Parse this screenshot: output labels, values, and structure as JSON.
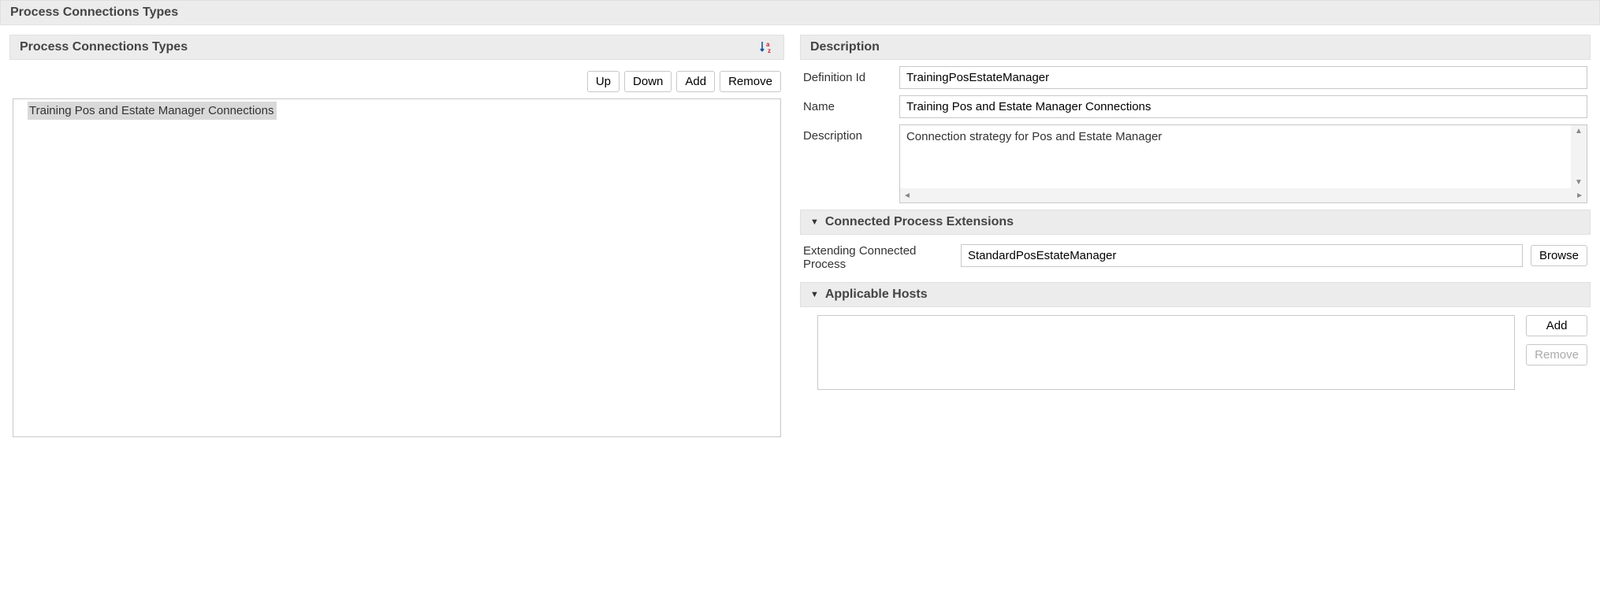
{
  "page_title": "Process Connections Types",
  "left": {
    "header": "Process Connections Types",
    "buttons": {
      "up": "Up",
      "down": "Down",
      "add": "Add",
      "remove": "Remove"
    },
    "items": [
      "Training Pos and Estate Manager Connections"
    ]
  },
  "description": {
    "header": "Description",
    "labels": {
      "definition_id": "Definition Id",
      "name": "Name",
      "description": "Description"
    },
    "values": {
      "definition_id": "TrainingPosEstateManager",
      "name": "Training Pos and Estate Manager Connections",
      "description": "Connection strategy for Pos and Estate Manager"
    }
  },
  "extensions": {
    "header": "Connected Process Extensions",
    "label": "Extending Connected Process",
    "value": "StandardPosEstateManager",
    "browse": "Browse"
  },
  "hosts": {
    "header": "Applicable Hosts",
    "add": "Add",
    "remove": "Remove"
  }
}
